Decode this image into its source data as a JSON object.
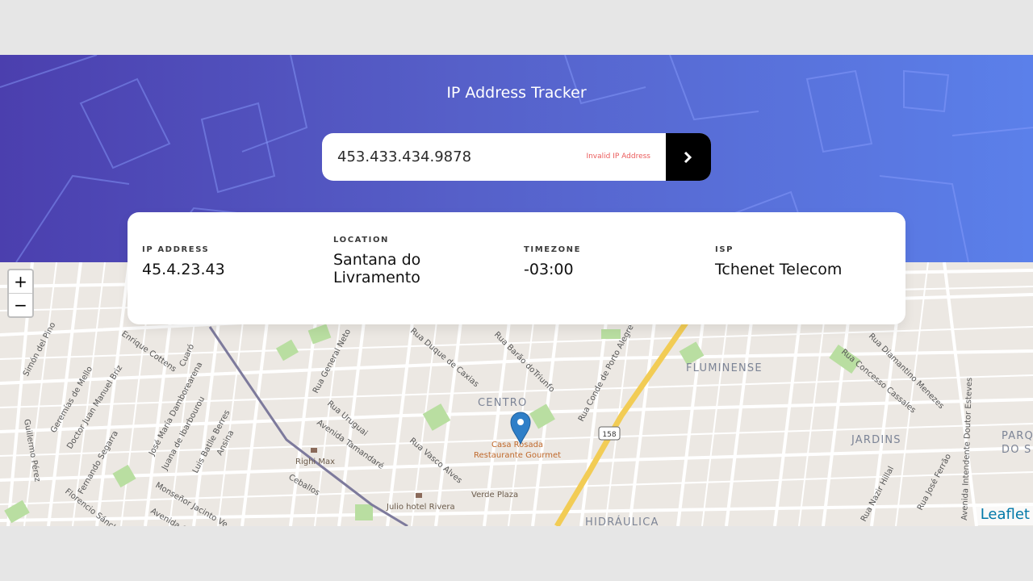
{
  "header": {
    "title": "IP Address Tracker"
  },
  "search": {
    "value": "453.433.434.9878",
    "error": "Invalid IP Address"
  },
  "info": [
    {
      "label": "IP ADDRESS",
      "value": "45.4.23.43"
    },
    {
      "label": "LOCATION",
      "value": "Santana do Livramento"
    },
    {
      "label": "TIMEZONE",
      "value": "-03:00"
    },
    {
      "label": "ISP",
      "value": "Tchenet Telecom"
    }
  ],
  "map": {
    "zoom_in": "+",
    "zoom_out": "−",
    "attribution": "Leaflet",
    "districts": [
      "FLUMINENSE",
      "CENTRO",
      "JARDINS",
      "HIDRÁULICA",
      "PARQ",
      "DO S"
    ],
    "streets": [
      "Simón del Pino",
      "Enrique Cottens",
      "Cuaró",
      "Geremías de Mello",
      "Doctor Juan Manuel Briz",
      "José María Damborearena",
      "Juana de Ibarbourou",
      "Luis Batlle Berres",
      "Ansina",
      "Guillermo Pérez",
      "Fernando Segarra",
      "Monseñor Jacinto Ve",
      "Avenida Gr",
      "Florencio Sánch",
      "Rua General Neto",
      "Rua Duque de Caxias",
      "Rua Barão doTriunfo",
      "Rua Conde de Porto Alegre",
      "Rua Uruguai",
      "Avenida Tamandaré",
      "Rua Vasco Alves",
      "Ceballos",
      "Rua Concesso Cassales",
      "Rua Diamantino Menezes",
      "Avenida Intendente Doutor Esteves",
      "Rua José Ferrão",
      "Rua Nazir Hillal"
    ],
    "pois": [
      "Righi Max",
      "Julio hotel Rivera",
      "Verde Plaza",
      "Casa Rosada",
      "Restaurante Gourmet"
    ],
    "route_number": "158"
  },
  "colors": {
    "accent": "#000000",
    "error": "#ea5a5a",
    "marker": "#2f7fc8",
    "highway": "#f2cc55"
  }
}
